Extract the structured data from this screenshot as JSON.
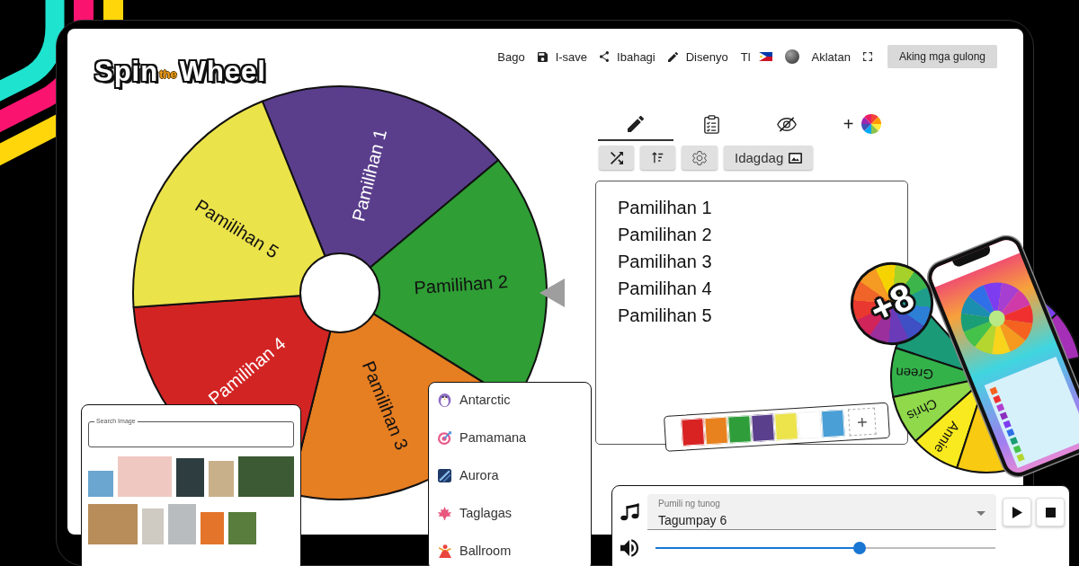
{
  "logo": {
    "parts": [
      "Spin",
      "the",
      "Wheel"
    ]
  },
  "nav": [
    {
      "kind": "new",
      "label": "Bago"
    },
    {
      "kind": "save",
      "label": "I-save"
    },
    {
      "kind": "share",
      "label": "Ibahagi"
    },
    {
      "kind": "design",
      "label": "Disenyo"
    },
    {
      "kind": "language",
      "label": "Tl"
    },
    {
      "kind": "theme"
    },
    {
      "kind": "library",
      "label": "Aklatan"
    },
    {
      "kind": "fullscreen"
    },
    {
      "kind": "wheels",
      "label": "Aking mga gulong"
    }
  ],
  "wheel": {
    "segments": [
      {
        "label": "Pamilihan 1",
        "color": "#5a3e8c"
      },
      {
        "label": "Pamilihan 2",
        "color": "#2f9e35"
      },
      {
        "label": "Pamilihan 3",
        "color": "#e67e22"
      },
      {
        "label": "Pamilihan 4",
        "color": "#d32424"
      },
      {
        "label": "Pamilihan 5",
        "color": "#ebe34a"
      }
    ]
  },
  "editor": {
    "tabs": [
      {
        "kind": "entries",
        "selected": true
      },
      {
        "kind": "results",
        "selected": false
      },
      {
        "kind": "hidden",
        "selected": false
      },
      {
        "kind": "colors",
        "label": "+",
        "selected": false
      }
    ],
    "tools": [
      {
        "kind": "shuffle"
      },
      {
        "kind": "sort"
      },
      {
        "kind": "settings"
      },
      {
        "kind": "image",
        "label": "Idagdag"
      }
    ],
    "entries": [
      "Pamilihan 1",
      "Pamilihan 2",
      "Pamilihan 3",
      "Pamilihan 4",
      "Pamilihan 5"
    ]
  },
  "palette": {
    "swatches": [
      {
        "color": "#d92323"
      },
      {
        "color": "#e8821e"
      },
      {
        "color": "#2f9e3a"
      },
      {
        "color": "#5a3f8c"
      },
      {
        "color": "#ece44a"
      },
      {
        "color": "#ffffff"
      },
      {
        "color": "#4a9fd6"
      }
    ],
    "add_label": "+"
  },
  "showcase_wheel": {
    "segments": [
      {
        "color": "#1b9a78"
      },
      {
        "label": "Green",
        "color": "#34b24a"
      },
      {
        "label": "Chris",
        "color": "#8fd94a"
      },
      {
        "label": "Annie",
        "color": "#f9ea1f"
      },
      {
        "color": "#f8cb12"
      },
      {
        "color": "#7b3ff0"
      },
      {
        "color": "#a52fb6"
      }
    ]
  },
  "badge": {
    "label": "+8"
  },
  "sound": {
    "label": "Pumili ng tunog",
    "value": "Tagumpay 6",
    "volume": {
      "level": 0.6
    }
  },
  "theme_menu": {
    "items": [
      {
        "label": "Antarctic"
      },
      {
        "label": "Pamamana"
      },
      {
        "label": "Aurora"
      },
      {
        "label": "Taglagas"
      },
      {
        "label": "Ballroom"
      }
    ]
  },
  "image_search": {
    "label": "Search Image"
  }
}
